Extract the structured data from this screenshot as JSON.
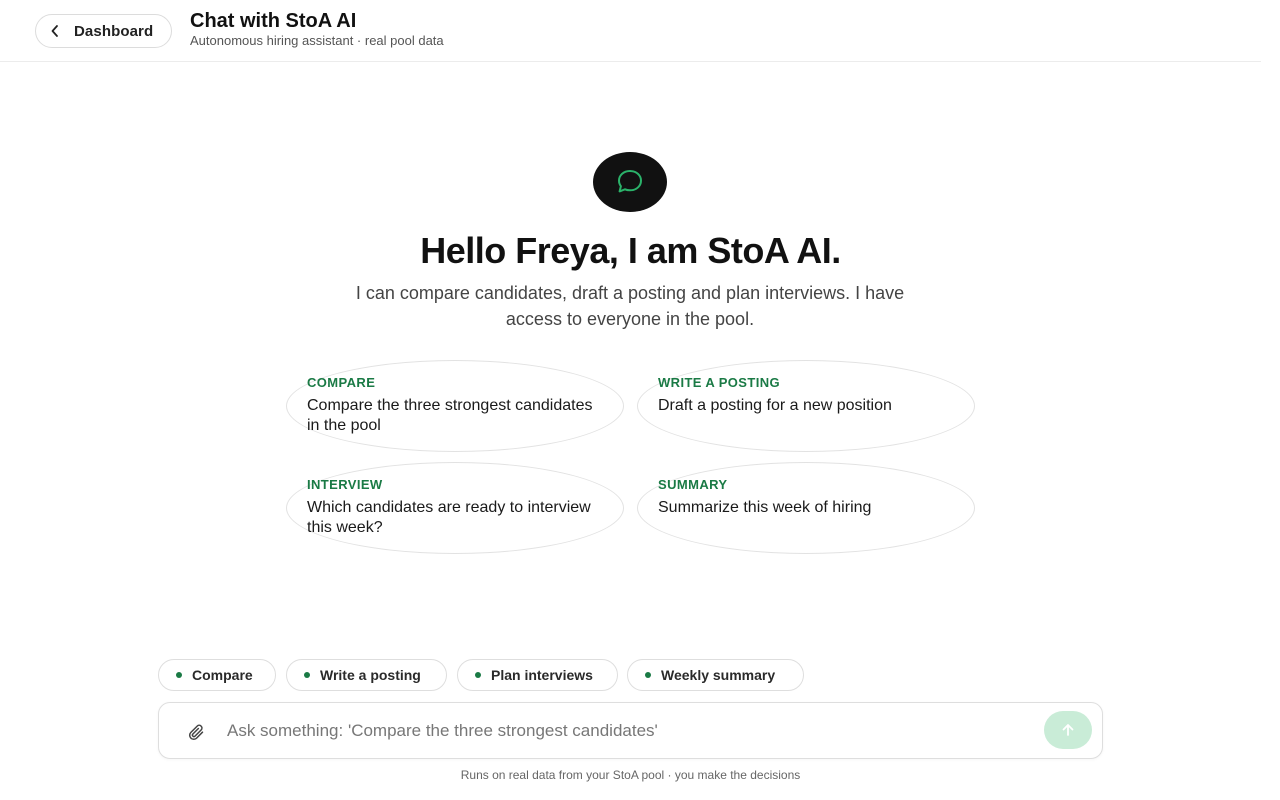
{
  "header": {
    "back_label": "Dashboard",
    "title": "Chat with StoA AI",
    "subtitle": "Autonomous hiring assistant · real pool data"
  },
  "hero": {
    "icon": "chat-bubble-icon",
    "title": "Hello Freya, I am StoA AI.",
    "description": "I can compare candidates, draft a posting and plan interviews. I have access to everyone in the pool."
  },
  "cards": [
    {
      "tag": "COMPARE",
      "text": "Compare the three strongest candidates in the pool"
    },
    {
      "tag": "WRITE A POSTING",
      "text": "Draft a posting for a new position"
    },
    {
      "tag": "INTERVIEW",
      "text": "Which candidates are ready to interview this week?"
    },
    {
      "tag": "SUMMARY",
      "text": "Summarize this week of hiring"
    }
  ],
  "chips": [
    {
      "label": "Compare"
    },
    {
      "label": "Write a posting"
    },
    {
      "label": "Plan interviews"
    },
    {
      "label": "Weekly summary"
    }
  ],
  "composer": {
    "placeholder": "Ask something: 'Compare the three strongest candidates'",
    "value": "",
    "attach_icon": "paperclip-icon",
    "send_icon": "arrow-up-icon"
  },
  "footnote": "Runs on real data from your StoA pool · you make the decisions",
  "colors": {
    "accent": "#1a7a45",
    "accent_light": "#c9ecd7",
    "hero_icon_bg": "#111111",
    "hero_icon_stroke": "#2bb36a"
  }
}
